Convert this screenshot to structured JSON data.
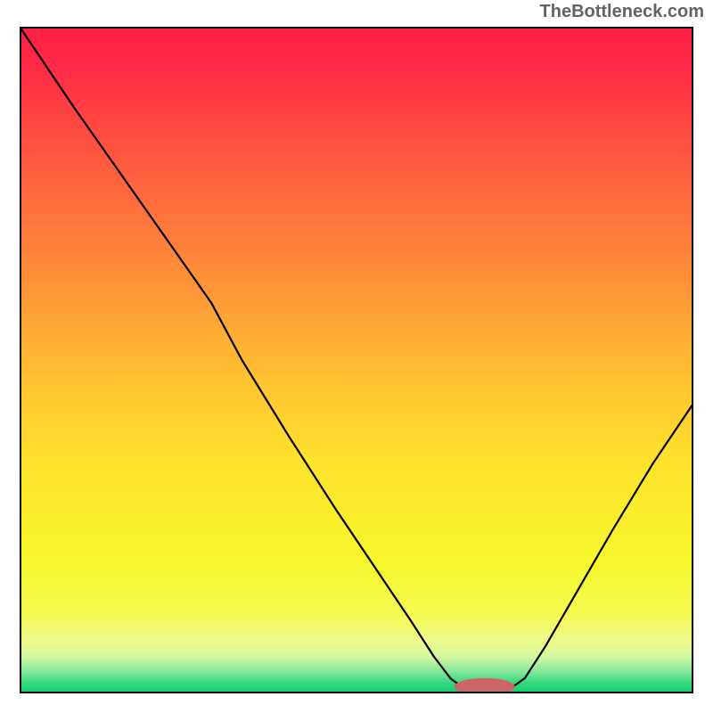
{
  "watermark": "TheBottleneck.com",
  "chart_data": {
    "type": "line",
    "title": "",
    "xlabel": "",
    "ylabel": "",
    "xlim": [
      0,
      100
    ],
    "ylim": [
      0,
      100
    ],
    "grid": false,
    "background": {
      "type": "vertical-gradient",
      "stops": [
        {
          "offset": 0.0,
          "color": "#ff1f47"
        },
        {
          "offset": 0.06,
          "color": "#ff2a45"
        },
        {
          "offset": 0.2,
          "color": "#ff5940"
        },
        {
          "offset": 0.35,
          "color": "#ff883a"
        },
        {
          "offset": 0.5,
          "color": "#ffb933"
        },
        {
          "offset": 0.65,
          "color": "#ffe22d"
        },
        {
          "offset": 0.8,
          "color": "#f7f62c"
        },
        {
          "offset": 0.88,
          "color": "#f4fa50"
        },
        {
          "offset": 0.92,
          "color": "#f0fb8a"
        },
        {
          "offset": 0.945,
          "color": "#d4f8a0"
        },
        {
          "offset": 0.965,
          "color": "#8de99e"
        },
        {
          "offset": 0.985,
          "color": "#34d77f"
        },
        {
          "offset": 1.0,
          "color": "#0ecf6b"
        }
      ]
    },
    "series": [
      {
        "name": "curve",
        "stroke": "#000000",
        "stroke_width": 2.2,
        "points": [
          {
            "x": 0.0,
            "y": 100.0
          },
          {
            "x": 8.0,
            "y": 88.0
          },
          {
            "x": 16.0,
            "y": 76.5
          },
          {
            "x": 24.0,
            "y": 65.0
          },
          {
            "x": 28.5,
            "y": 58.5
          },
          {
            "x": 33.0,
            "y": 50.0
          },
          {
            "x": 40.0,
            "y": 38.5
          },
          {
            "x": 47.0,
            "y": 27.5
          },
          {
            "x": 54.0,
            "y": 17.0
          },
          {
            "x": 58.0,
            "y": 11.0
          },
          {
            "x": 61.5,
            "y": 5.5
          },
          {
            "x": 64.0,
            "y": 2.2
          },
          {
            "x": 65.5,
            "y": 1.1
          },
          {
            "x": 67.0,
            "y": 1.0
          },
          {
            "x": 72.0,
            "y": 1.0
          },
          {
            "x": 73.5,
            "y": 1.2
          },
          {
            "x": 75.0,
            "y": 2.3
          },
          {
            "x": 78.0,
            "y": 7.0
          },
          {
            "x": 82.0,
            "y": 14.0
          },
          {
            "x": 88.0,
            "y": 24.5
          },
          {
            "x": 94.0,
            "y": 34.5
          },
          {
            "x": 100.0,
            "y": 43.5
          }
        ]
      }
    ],
    "marker": {
      "cx": 69.0,
      "cy": 1.0,
      "rx": 4.5,
      "ry": 1.3,
      "fill": "#cc6666"
    },
    "border": {
      "stroke": "#000000",
      "stroke_width": 4
    }
  }
}
